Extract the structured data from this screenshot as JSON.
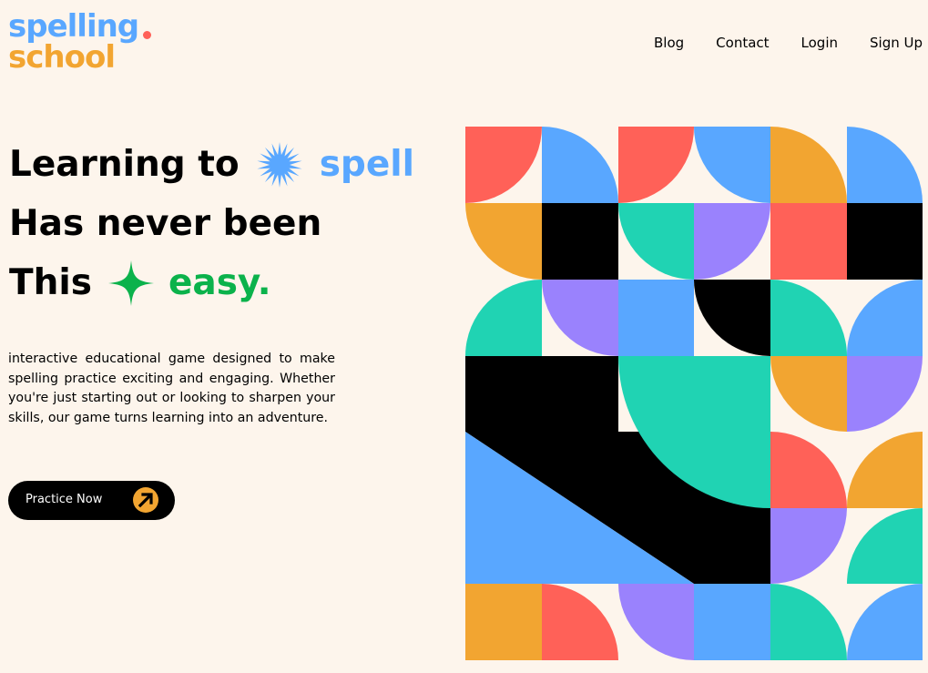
{
  "brand": {
    "line1": "spelling",
    "line2": "school",
    "colors": {
      "blue": "#59a7ff",
      "orange": "#f2a531",
      "red": "#ff6158"
    }
  },
  "nav": {
    "items": [
      {
        "label": "Blog"
      },
      {
        "label": "Contact"
      },
      {
        "label": "Login"
      },
      {
        "label": "Sign Up"
      }
    ]
  },
  "hero": {
    "line1": "Learning to",
    "line1_highlight": "spell",
    "line2": "Has never been",
    "line3": "This",
    "line3_highlight": "easy.",
    "icons": [
      "starburst-icon",
      "sparkle-icon"
    ]
  },
  "description": "interactive educational game designed to make spelling practice exciting and engaging. Whether you're just starting out or looking to sharpen your skills, our game turns learning into an adventure.",
  "cta": {
    "label": "Practice Now",
    "icon": "arrow-up-right-icon"
  },
  "palette": {
    "red": "#ff6158",
    "blue": "#59a7ff",
    "orange": "#f2a531",
    "teal": "#20d3b3",
    "purple": "#9a82fd",
    "black": "#000000",
    "green": "#0bb24b"
  }
}
